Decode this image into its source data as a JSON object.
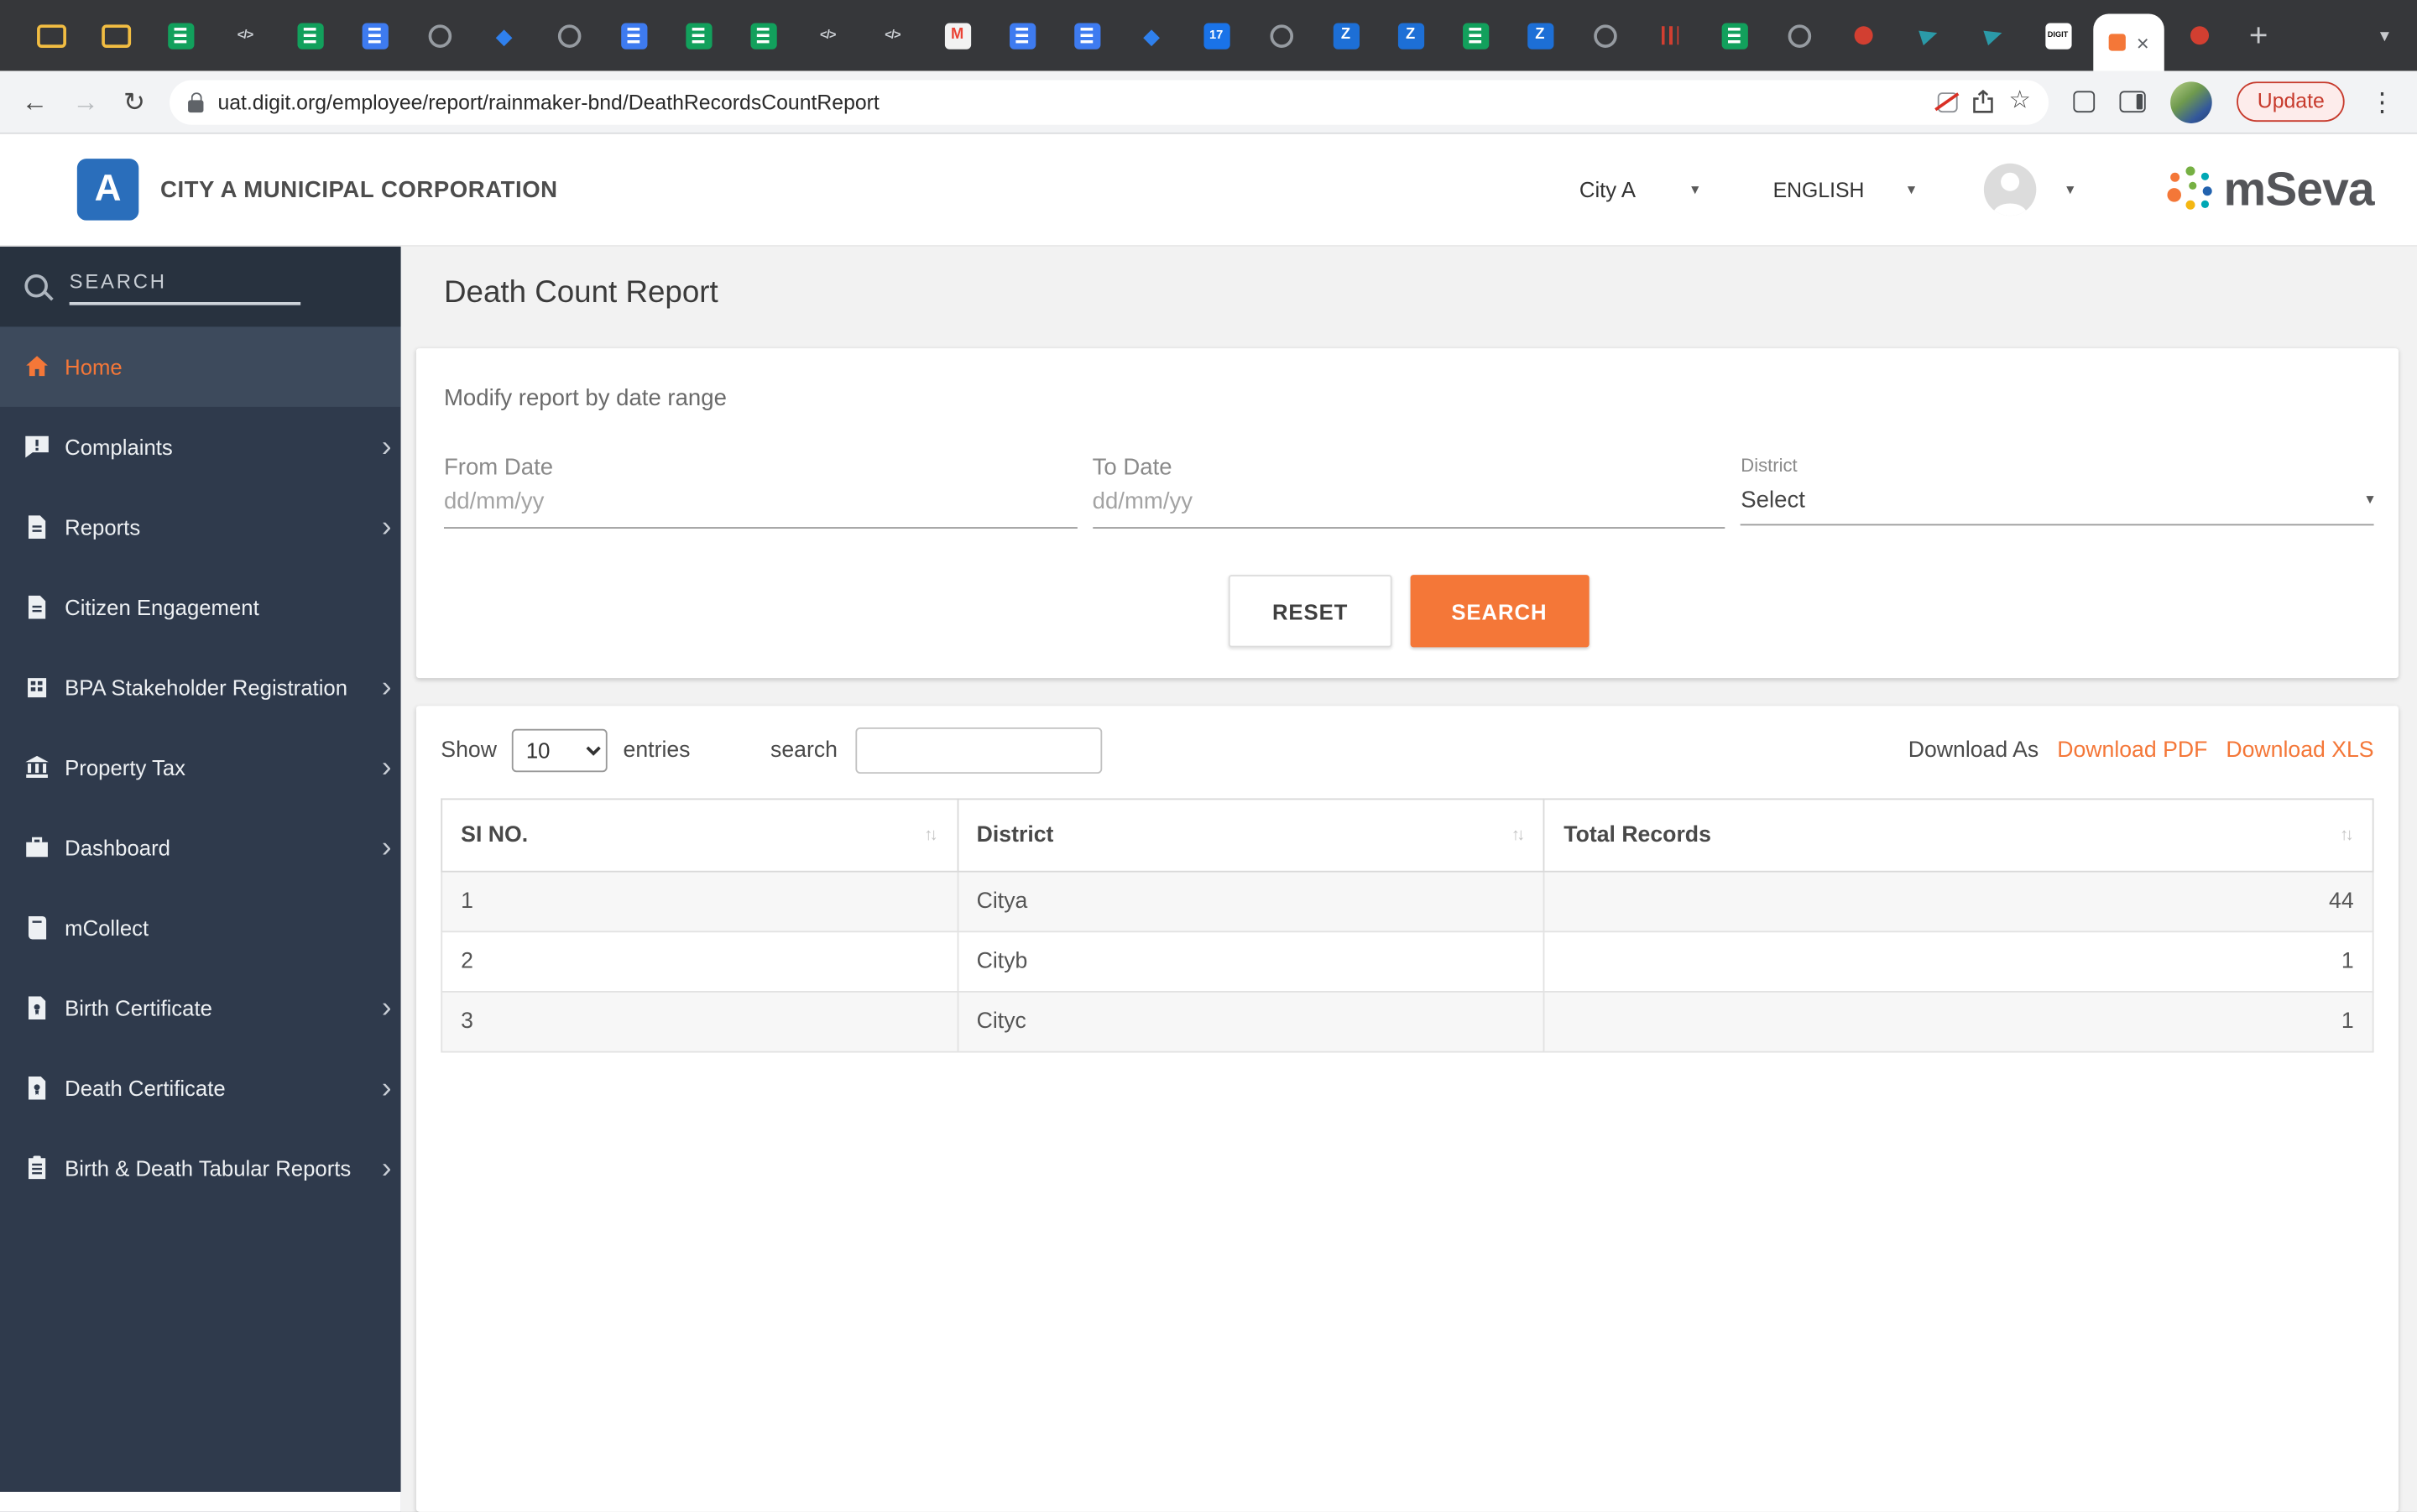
{
  "colors": {
    "accent": "#f47738",
    "sidebar_bg": "#2f3a4c",
    "sidebar_active_bg": "#3d4a5c",
    "header_logo_blue": "#2a6ebb"
  },
  "icons": {
    "caret_down": "▾",
    "chevron_right": "›",
    "sort": "↑↓",
    "close": "×",
    "plus": "+",
    "back": "←",
    "forward": "→",
    "reload": "↻",
    "star": "☆",
    "menu": "⋮",
    "tab_search": "▾"
  },
  "browser": {
    "pinned_tabs": [
      {
        "name": "pinned-tab-folder",
        "type": "folder"
      },
      {
        "name": "pinned-tab-folder",
        "type": "folder"
      },
      {
        "name": "pinned-tab-sheets",
        "type": "sheets"
      },
      {
        "name": "pinned-tab-code",
        "type": "code",
        "glyph": "</>"
      },
      {
        "name": "pinned-tab-sheets",
        "type": "sheets"
      },
      {
        "name": "pinned-tab-docs",
        "type": "docs"
      },
      {
        "name": "pinned-tab-globe",
        "type": "globe"
      },
      {
        "name": "pinned-tab-jira",
        "type": "jira",
        "glyph": "◆"
      },
      {
        "name": "pinned-tab-globe",
        "type": "globe"
      },
      {
        "name": "pinned-tab-docs",
        "type": "docs"
      },
      {
        "name": "pinned-tab-sheets",
        "type": "sheets"
      },
      {
        "name": "pinned-tab-sheets",
        "type": "sheets"
      },
      {
        "name": "pinned-tab-code",
        "type": "code",
        "glyph": "</>"
      },
      {
        "name": "pinned-tab-code",
        "type": "code",
        "glyph": "</>"
      },
      {
        "name": "pinned-tab-gmail",
        "type": "gmail",
        "glyph": "M"
      },
      {
        "name": "pinned-tab-docs",
        "type": "docs"
      },
      {
        "name": "pinned-tab-docs",
        "type": "docs"
      },
      {
        "name": "pinned-tab-jira",
        "type": "jira",
        "glyph": "◆"
      },
      {
        "name": "pinned-tab-calendar",
        "type": "calendar",
        "glyph": "17"
      },
      {
        "name": "pinned-tab-globe",
        "type": "globe"
      },
      {
        "name": "pinned-tab-zoho",
        "type": "zoho",
        "glyph": "Z"
      },
      {
        "name": "pinned-tab-zoho",
        "type": "zoho",
        "glyph": "Z"
      },
      {
        "name": "pinned-tab-sheets",
        "type": "sheets"
      },
      {
        "name": "pinned-tab-zoho",
        "type": "zoho",
        "glyph": "Z"
      },
      {
        "name": "pinned-tab-globe",
        "type": "globe"
      },
      {
        "name": "pinned-tab-redbars",
        "type": "bars"
      },
      {
        "name": "pinned-tab-sheets",
        "type": "sheets"
      },
      {
        "name": "pinned-tab-globe",
        "type": "globe"
      },
      {
        "name": "pinned-tab-reddot",
        "type": "redcircle"
      },
      {
        "name": "pinned-tab-plane",
        "type": "plane"
      },
      {
        "name": "pinned-tab-plane",
        "type": "plane"
      },
      {
        "name": "pinned-tab-digit",
        "type": "digit",
        "glyph": "DIGIT"
      }
    ],
    "pinned_tabs_after": [
      {
        "name": "pinned-tab-reddot",
        "type": "redcircle"
      }
    ],
    "toolbar": {
      "url": "uat.digit.org/employee/report/rainmaker-bnd/DeathRecordsCountReport",
      "update_label": "Update"
    }
  },
  "header": {
    "logo_letter": "A",
    "org_name": "CITY A MUNICIPAL CORPORATION",
    "city_label": "City A",
    "language_label": "ENGLISH",
    "brand": "mSeva"
  },
  "sidebar": {
    "search_placeholder": "SEARCH",
    "items": [
      {
        "label": "Home",
        "active": true
      },
      {
        "label": "Complaints"
      },
      {
        "label": "Reports"
      },
      {
        "label": "Citizen Engagement"
      },
      {
        "label": "BPA Stakeholder Registration"
      },
      {
        "label": "Property Tax"
      },
      {
        "label": "Dashboard"
      },
      {
        "label": "mCollect"
      },
      {
        "label": "Birth Certificate"
      },
      {
        "label": "Death Certificate"
      },
      {
        "label": "Birth & Death Tabular Reports"
      }
    ]
  },
  "report": {
    "title": "Death Count Report",
    "filters": {
      "heading": "Modify report by date range",
      "from_date_label": "From Date",
      "from_date_placeholder": "dd/mm/yy",
      "from_date_value": "",
      "to_date_label": "To Date",
      "to_date_placeholder": "dd/mm/yy",
      "to_date_value": "",
      "district_label": "District",
      "district_value": "Select",
      "reset_label": "RESET",
      "search_label": "SEARCH"
    },
    "list": {
      "show_label": "Show",
      "page_size": "10",
      "entries_label": "entries",
      "search_label": "search",
      "search_value": "",
      "download_as_label": "Download As",
      "download_pdf_label": "Download PDF",
      "download_xls_label": "Download XLS"
    }
  },
  "table": {
    "columns": [
      "SI NO.",
      "District",
      "Total Records"
    ],
    "rows": [
      [
        "1",
        "Citya",
        "44"
      ],
      [
        "2",
        "Cityb",
        "1"
      ],
      [
        "3",
        "Cityc",
        "1"
      ]
    ]
  }
}
